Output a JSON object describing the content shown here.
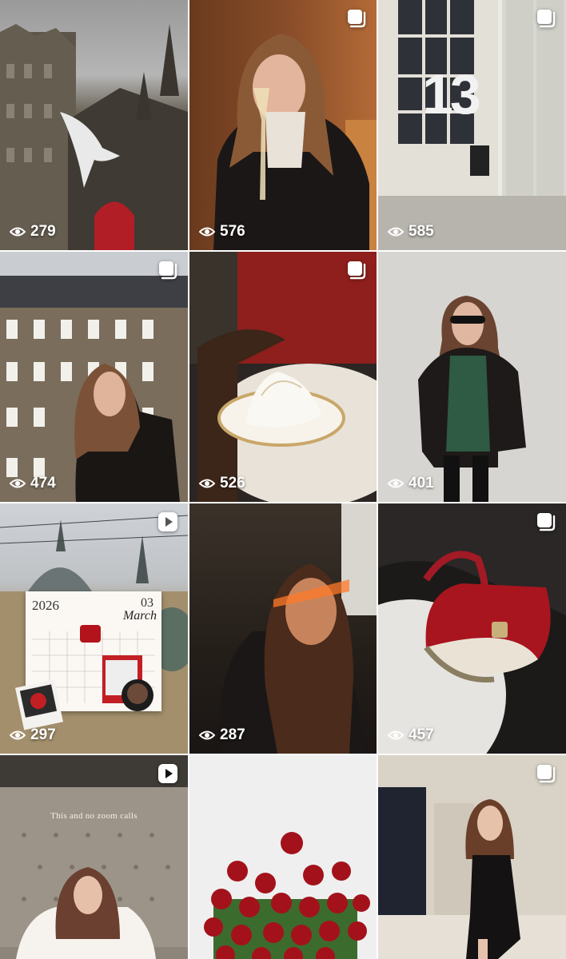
{
  "grid": {
    "tiles": [
      {
        "views": "279",
        "badge": "none"
      },
      {
        "views": "576",
        "badge": "carousel-icon"
      },
      {
        "views": "585",
        "badge": "carousel-icon"
      },
      {
        "views": "474",
        "badge": "carousel-icon"
      },
      {
        "views": "526",
        "badge": "carousel-icon"
      },
      {
        "views": "401",
        "badge": "none"
      },
      {
        "views": "297",
        "badge": "reel-icon"
      },
      {
        "views": "287",
        "badge": "none"
      },
      {
        "views": "457",
        "badge": "carousel-icon"
      },
      {
        "views": "",
        "badge": "reel-icon"
      },
      {
        "views": "",
        "badge": "none"
      },
      {
        "views": "",
        "badge": "carousel-icon"
      }
    ]
  },
  "overlays": {
    "door_number": "13",
    "calendar_year": "2026",
    "calendar_day": "03",
    "calendar_month": "March",
    "video_caption": "This and no zoom calls"
  },
  "colors": {
    "icon": "#ffffff",
    "divider": "#ffffff"
  }
}
